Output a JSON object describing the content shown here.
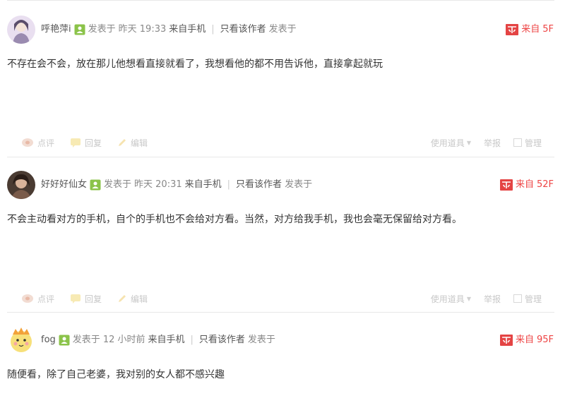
{
  "posts": [
    {
      "username": "呼艳萍i",
      "posted_label": "发表于",
      "time": "昨天 19:33",
      "source": "来自手机",
      "only_author": "只看该作者",
      "posted_label2": "发表于",
      "floor_prefix": "来自",
      "floor": "5F",
      "content": "不存在会不会，放在那儿他想看直接就看了，我想看他的都不用告诉他，直接拿起就玩",
      "actions": {
        "comment": "点评",
        "reply": "回复",
        "edit": "编辑"
      },
      "tools": {
        "use_item": "使用道具",
        "report": "举报",
        "manage": "管理"
      }
    },
    {
      "username": "好好好仙女",
      "posted_label": "发表于",
      "time": "昨天 20:31",
      "source": "来自手机",
      "only_author": "只看该作者",
      "posted_label2": "发表于",
      "floor_prefix": "来自",
      "floor": "52F",
      "content": "不会主动看对方的手机，自个的手机也不会给对方看。当然，对方给我手机，我也会毫无保留给对方看。",
      "actions": {
        "comment": "点评",
        "reply": "回复",
        "edit": "编辑"
      },
      "tools": {
        "use_item": "使用道具",
        "report": "举报",
        "manage": "管理"
      }
    },
    {
      "username": "fog",
      "posted_label": "发表于",
      "time": "12 小时前",
      "source": "来自手机",
      "only_author": "只看该作者",
      "posted_label2": "发表于",
      "floor_prefix": "来自",
      "floor": "95F",
      "content": "随便看，除了自己老婆，我对别的女人都不感兴趣"
    }
  ],
  "colors": {
    "accent_red": "#e44444",
    "level_green": "#8bc34a",
    "muted": "#c8c8c8"
  },
  "icons": [
    "avatar",
    "user-level-icon",
    "mobile-floor-icon",
    "comment-icon",
    "reply-icon",
    "edit-icon",
    "checkbox-icon"
  ]
}
